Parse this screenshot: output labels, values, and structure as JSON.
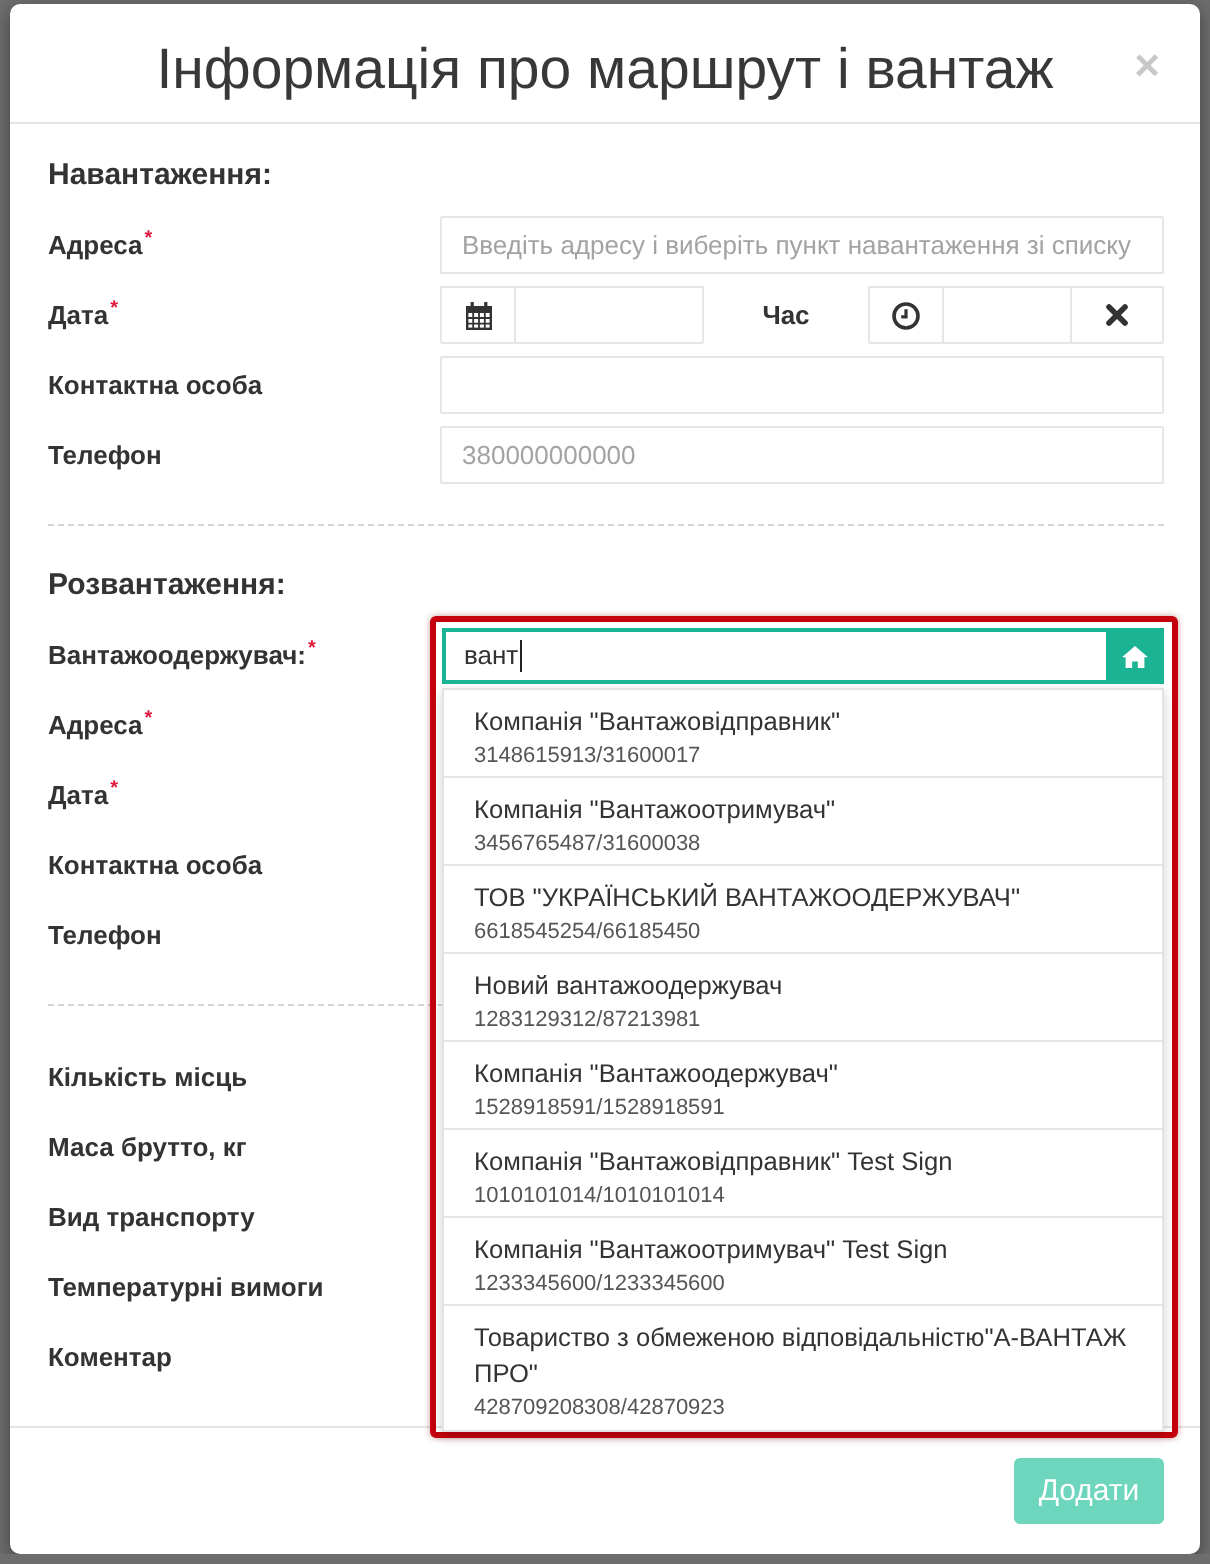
{
  "dialog": {
    "title": "Інформація про маршрут і вантаж",
    "close": "×"
  },
  "loading": {
    "heading": "Навантаження:",
    "fields": [
      {
        "kind": "text",
        "label": "Адреса$^{*}$",
        "placeholder": "Введіть адресу і виберіть пункт навантаження зі списку"
      },
      {
        "kind": "datetime",
        "label": "Дата$^{*}$",
        "time_label": "Час"
      },
      {
        "kind": "text",
        "label": "Контактна особа"
      },
      {
        "kind": "text",
        "label": "Телефон",
        "placeholder": "380000000000"
      }
    ]
  },
  "unloading": {
    "heading": "Розвантаження:",
    "fields": [
      {
        "kind": "autocomplete",
        "label": "Вантажоодержувач:$^{*}$",
        "value": "вант",
        "focused": true,
        "highlighted": true,
        "suggestions": [
          {
            "name": "Компанія \"Вантажовідправник\"",
            "code": "3148615913/31600017"
          },
          {
            "name": "Компанія \"Вантажоотримувач\"",
            "code": "3456765487/31600038"
          },
          {
            "name": "ТОВ \"УКРАЇНСЬКИЙ ВАНТАЖООДЕРЖУВАЧ\"",
            "code": "6618545254/66185450"
          },
          {
            "name": "Новий вантажоодержувач",
            "code": "1283129312/87213981"
          },
          {
            "name": "Компанія \"Вантажоодержувач\"",
            "code": "1528918591/1528918591"
          },
          {
            "name": "Компанія \"Вантажовідправник\" Test Sign",
            "code": "1010101014/1010101014"
          },
          {
            "name": "Компанія \"Вантажоотримувач\" Test Sign",
            "code": "1233345600/1233345600"
          },
          {
            "name": "Товариство з обмеженою відповідальністю\"А-ВАНТАЖ ПРО\"",
            "code": "428709208308/42870923"
          }
        ]
      },
      {
        "label": "Адреса$^{*}$"
      },
      {
        "label": "Дата$^{*}$"
      },
      {
        "label": "Контактна особа"
      },
      {
        "label": "Телефон"
      }
    ]
  },
  "cargo": {
    "fields": [
      {
        "label": "Кількість місць"
      },
      {
        "label": "Маса брутто, кг"
      },
      {
        "label": "Вид транспорту"
      },
      {
        "label": "Температурні вимоги"
      },
      {
        "label": "Коментар"
      }
    ]
  },
  "footer": {
    "submit": {
      "label": "Додати",
      "disabled": true
    }
  }
}
